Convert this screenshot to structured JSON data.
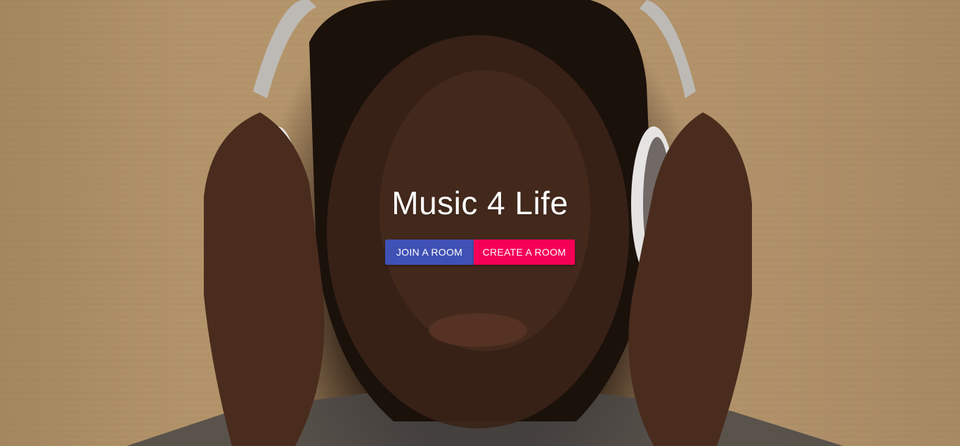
{
  "hero": {
    "background_image": "woman-with-headphones-photo",
    "title": "Music 4 Life"
  },
  "actions": {
    "join_label": "JOIN A ROOM",
    "create_label": "CREATE A ROOM"
  },
  "colors": {
    "primary": "#3f51b5",
    "secondary": "#f50057",
    "title_text": "#ffffff"
  }
}
